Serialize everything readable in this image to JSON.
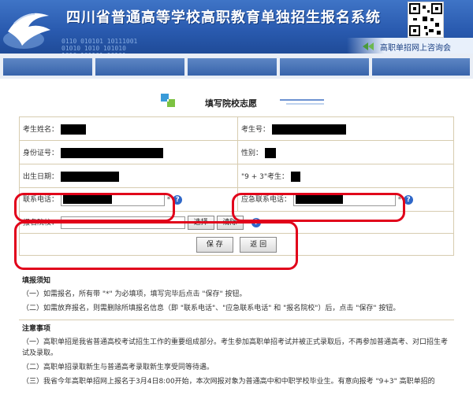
{
  "header": {
    "title": "四川省普通高等学校高职教育单独招生报名系统",
    "subtitle": "高职单招网上咨询会",
    "binary_text": "0110 010101 10111001\n01010 1010 101010\n1010 101101 10101"
  },
  "form": {
    "title": "填写院校志愿",
    "name_label": "考生姓名：",
    "exam_no_label": "考生号：",
    "id_label": "身份证号：",
    "gender_label": "性别：",
    "birth_label": "出生日期：",
    "type_label": "\"9 + 3\"考生：",
    "phone_label": "联系电话：",
    "emergency_label": "应急联系电话：",
    "school_label": "报名院校：",
    "required_mark": "*",
    "help_glyph": "?",
    "select_button": "选择",
    "clear_button": "清除",
    "save_button": "保 存",
    "back_button": "返 回"
  },
  "notice": {
    "title": "填报须知",
    "items": [
      "（一）如需报名，所有带 \"*\" 为必填项，填写完毕后点击 \"保存\" 按钮。",
      "（二）如需放弃报名，则需删除所填报名信息（即 \"联系电话\"、\"应急联系电话\" 和 \"报名院校\"）后，点击 \"保存\" 按钮。"
    ]
  },
  "attention": {
    "title": "注意事项",
    "items": [
      "（一）高职单招是我省普通高校考试招生工作的重要组成部分。考生参加高职单招考试并被正式录取后，不再参加普通高考、对口招生考试及录取。",
      "（二）高职单招录取新生与普通高考录取新生享受同等待遇。",
      "（三）我省今年高职单招网上报名于3月4日8:00开始，本次网报对象为普通高中和中职学校毕业生。有意向报考 \"9+3\" 高职单招的"
    ]
  },
  "colors": {
    "banner": "#2a5bb0",
    "highlight": "#e1001a",
    "table_border": "#d7ccb0",
    "redacted": "#000000"
  }
}
